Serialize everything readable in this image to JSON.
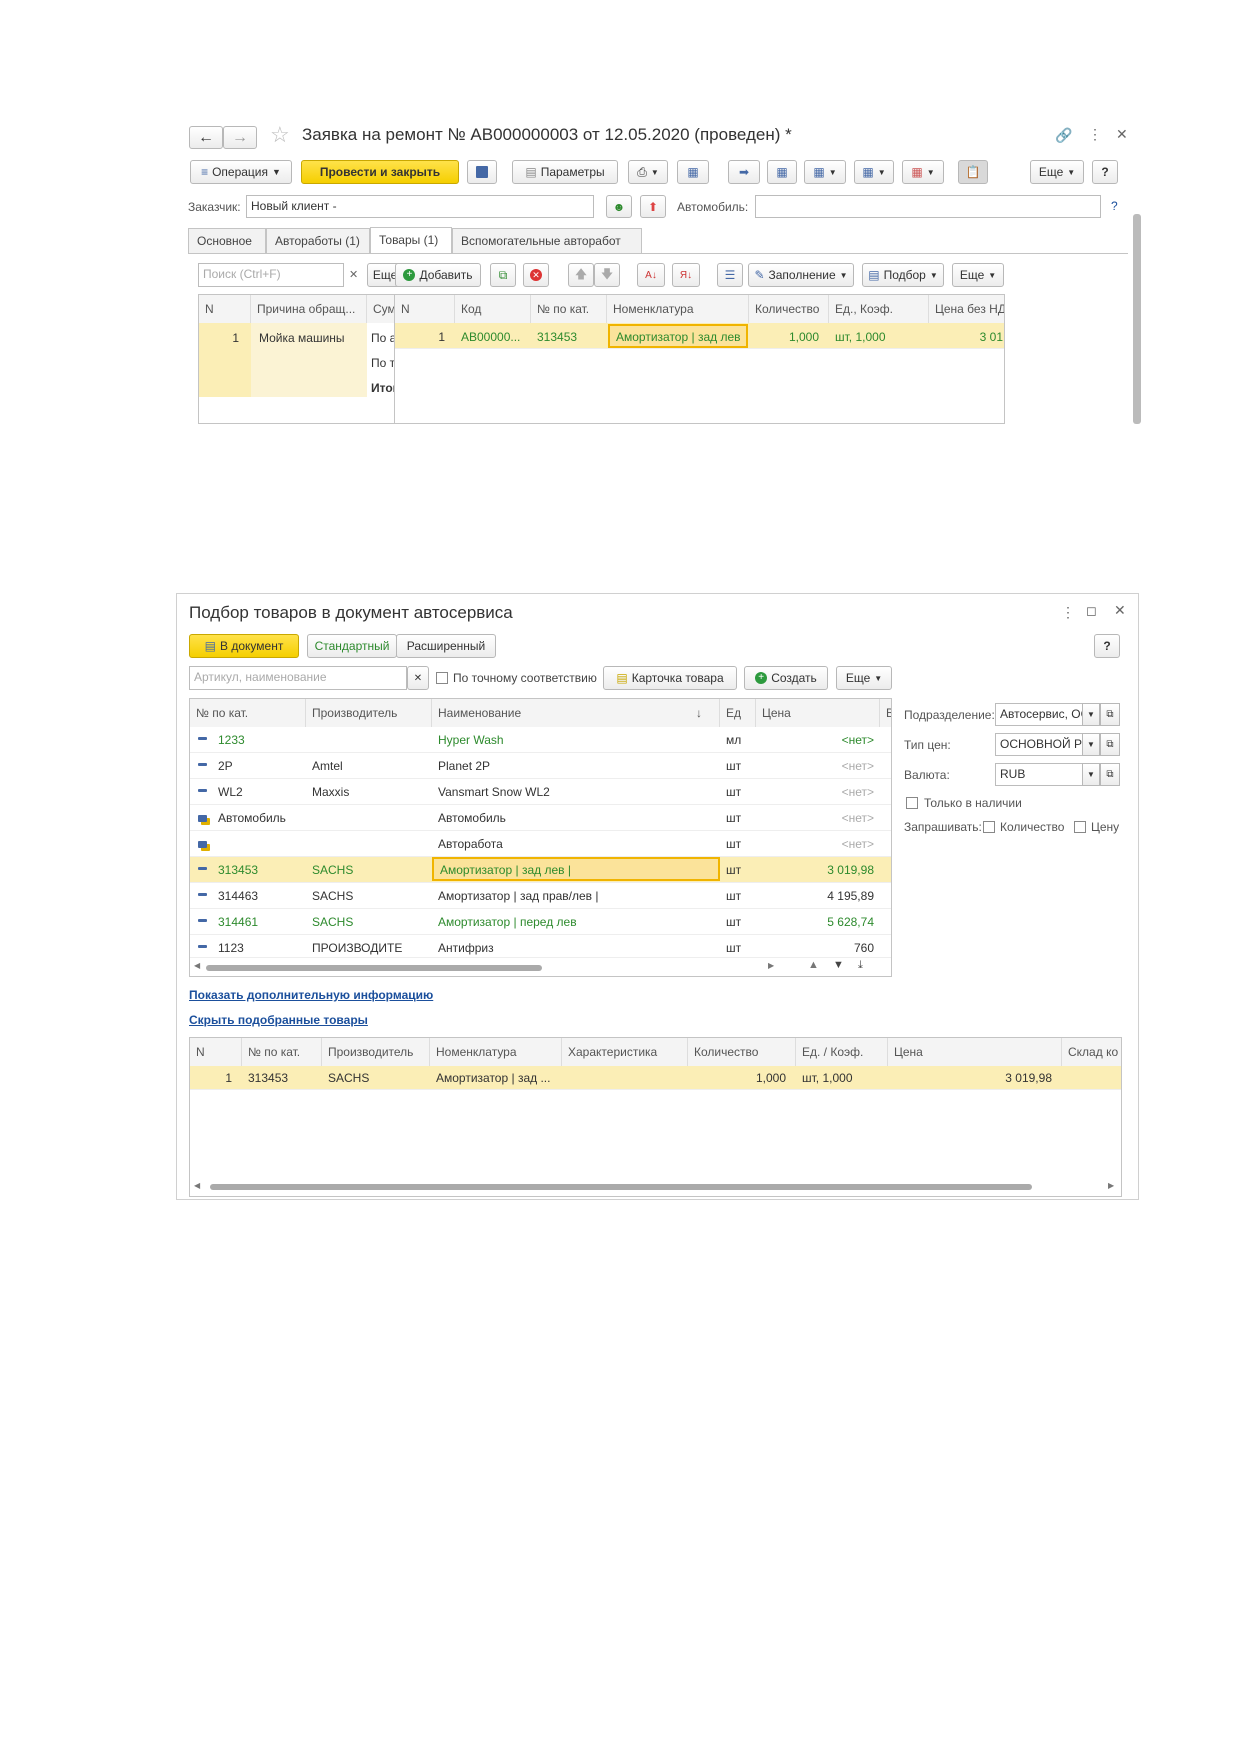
{
  "doc": {
    "title": "Заявка на ремонт № АВ000000003 от 12.05.2020 (проведен) *",
    "toolbar": {
      "operation": "Операция",
      "post_close": "Провести и закрыть",
      "params": "Параметры",
      "more": "Еще",
      "help": "?"
    },
    "customer_label": "Заказчик:",
    "customer_value": "Новый клиент -",
    "car_label": "Автомобиль:",
    "car_value": "",
    "help_q": "?",
    "tabs": [
      "Основное",
      "Автоработы (1)",
      "Товары (1)",
      "Вспомогательные авторабот"
    ],
    "left": {
      "search_placeholder": "Поиск (Ctrl+F)",
      "more": "Еще",
      "headers": [
        "N",
        "Причина обращ...",
        "Суммы"
      ],
      "row": {
        "n": "1",
        "reason": "Мойка машины",
        "sums": [
          "По авто",
          "По това",
          "Итого:"
        ]
      }
    },
    "right": {
      "add": "Добавить",
      "fill": "Заполнение",
      "pick": "Подбор",
      "more": "Еще",
      "headers": [
        "N",
        "Код",
        "№ по кат.",
        "Номенклатура",
        "Количество",
        "Ед., Коэф.",
        "Цена без НД"
      ],
      "row": {
        "n": "1",
        "code": "АВ00000...",
        "cat": "313453",
        "nom": "Амортизатор | зад лев",
        "qty": "1,000",
        "unit": "шт, 1,000",
        "price": "3 01"
      }
    }
  },
  "pick": {
    "title": "Подбор товаров в документ автосервиса",
    "to_doc": "В документ",
    "std": "Стандартный",
    "ext": "Расширенный",
    "help": "?",
    "search_placeholder": "Артикул, наименование",
    "exact": "По точному соответствию",
    "card": "Карточка товара",
    "create": "Создать",
    "more": "Еще",
    "headers": [
      "№ по кат.",
      "Производитель",
      "Наименование",
      "Ед",
      "Цена",
      "В"
    ],
    "rows": [
      {
        "cat": "1233",
        "mfr": "",
        "name": "Hyper Wash",
        "unit": "мл",
        "price": "<нет>",
        "style": "green",
        "icon": "dash"
      },
      {
        "cat": "2P",
        "mfr": "Amtel",
        "name": "Planet 2P",
        "unit": "шт",
        "price": "<нет>",
        "style": "plain",
        "icon": "dash"
      },
      {
        "cat": "WL2",
        "mfr": "Maxxis",
        "name": "Vansmart Snow WL2",
        "unit": "шт",
        "price": "<нет>",
        "style": "plain",
        "icon": "dash"
      },
      {
        "cat": "Автомобиль",
        "mfr": "",
        "name": "Автомобиль",
        "unit": "шт",
        "price": "<нет>",
        "style": "plain",
        "icon": "group"
      },
      {
        "cat": "",
        "mfr": "",
        "name": "Авторабота",
        "unit": "шт",
        "price": "<нет>",
        "style": "plain",
        "icon": "group"
      },
      {
        "cat": "313453",
        "mfr": "SACHS",
        "name": "Амортизатор | зад лев |",
        "unit": "шт",
        "price": "3 019,98",
        "style": "selected",
        "icon": "dash"
      },
      {
        "cat": "314463",
        "mfr": "SACHS",
        "name": "Амортизатор | зад прав/лев |",
        "unit": "шт",
        "price": "4 195,89",
        "style": "plain",
        "icon": "dash"
      },
      {
        "cat": "314461",
        "mfr": "SACHS",
        "name": "Амортизатор | перед лев",
        "unit": "шт",
        "price": "5 628,74",
        "style": "green",
        "icon": "dash"
      },
      {
        "cat": "1123",
        "mfr": "ПРОИЗВОДИТЕ",
        "name": "Антифриз",
        "unit": "шт",
        "price": "760",
        "style": "plain",
        "icon": "dash"
      }
    ],
    "side": {
      "division_label": "Подразделение:",
      "division_value": "Автосервис, ОС",
      "pricetype_label": "Тип цен:",
      "pricetype_value": "ОСНОВНОЙ РУ",
      "currency_label": "Валюта:",
      "currency_value": "RUB",
      "in_stock": "Только в наличии",
      "ask_label": "Запрашивать:",
      "ask_qty": "Количество",
      "ask_price": "Цену"
    },
    "link_more": "Показать дополнительную информацию",
    "link_hide": "Скрыть подобранные товары",
    "bottom": {
      "headers": [
        "N",
        "№ по кат.",
        "Производитель",
        "Номенклатура",
        "Характеристика",
        "Количество",
        "Ед. / Коэф.",
        "Цена",
        "Склад ко"
      ],
      "row": {
        "n": "1",
        "cat": "313453",
        "mfr": "SACHS",
        "nom": "Амортизатор | зад ...",
        "char": "",
        "qty": "1,000",
        "unit": "шт, 1,000",
        "price": "3 019,98",
        "store": ""
      }
    }
  },
  "colors": {
    "accent": "#f5cf00",
    "selected_row": "#fbeeb6",
    "green_text": "#2d8a2d",
    "link": "#1b4f9c"
  }
}
